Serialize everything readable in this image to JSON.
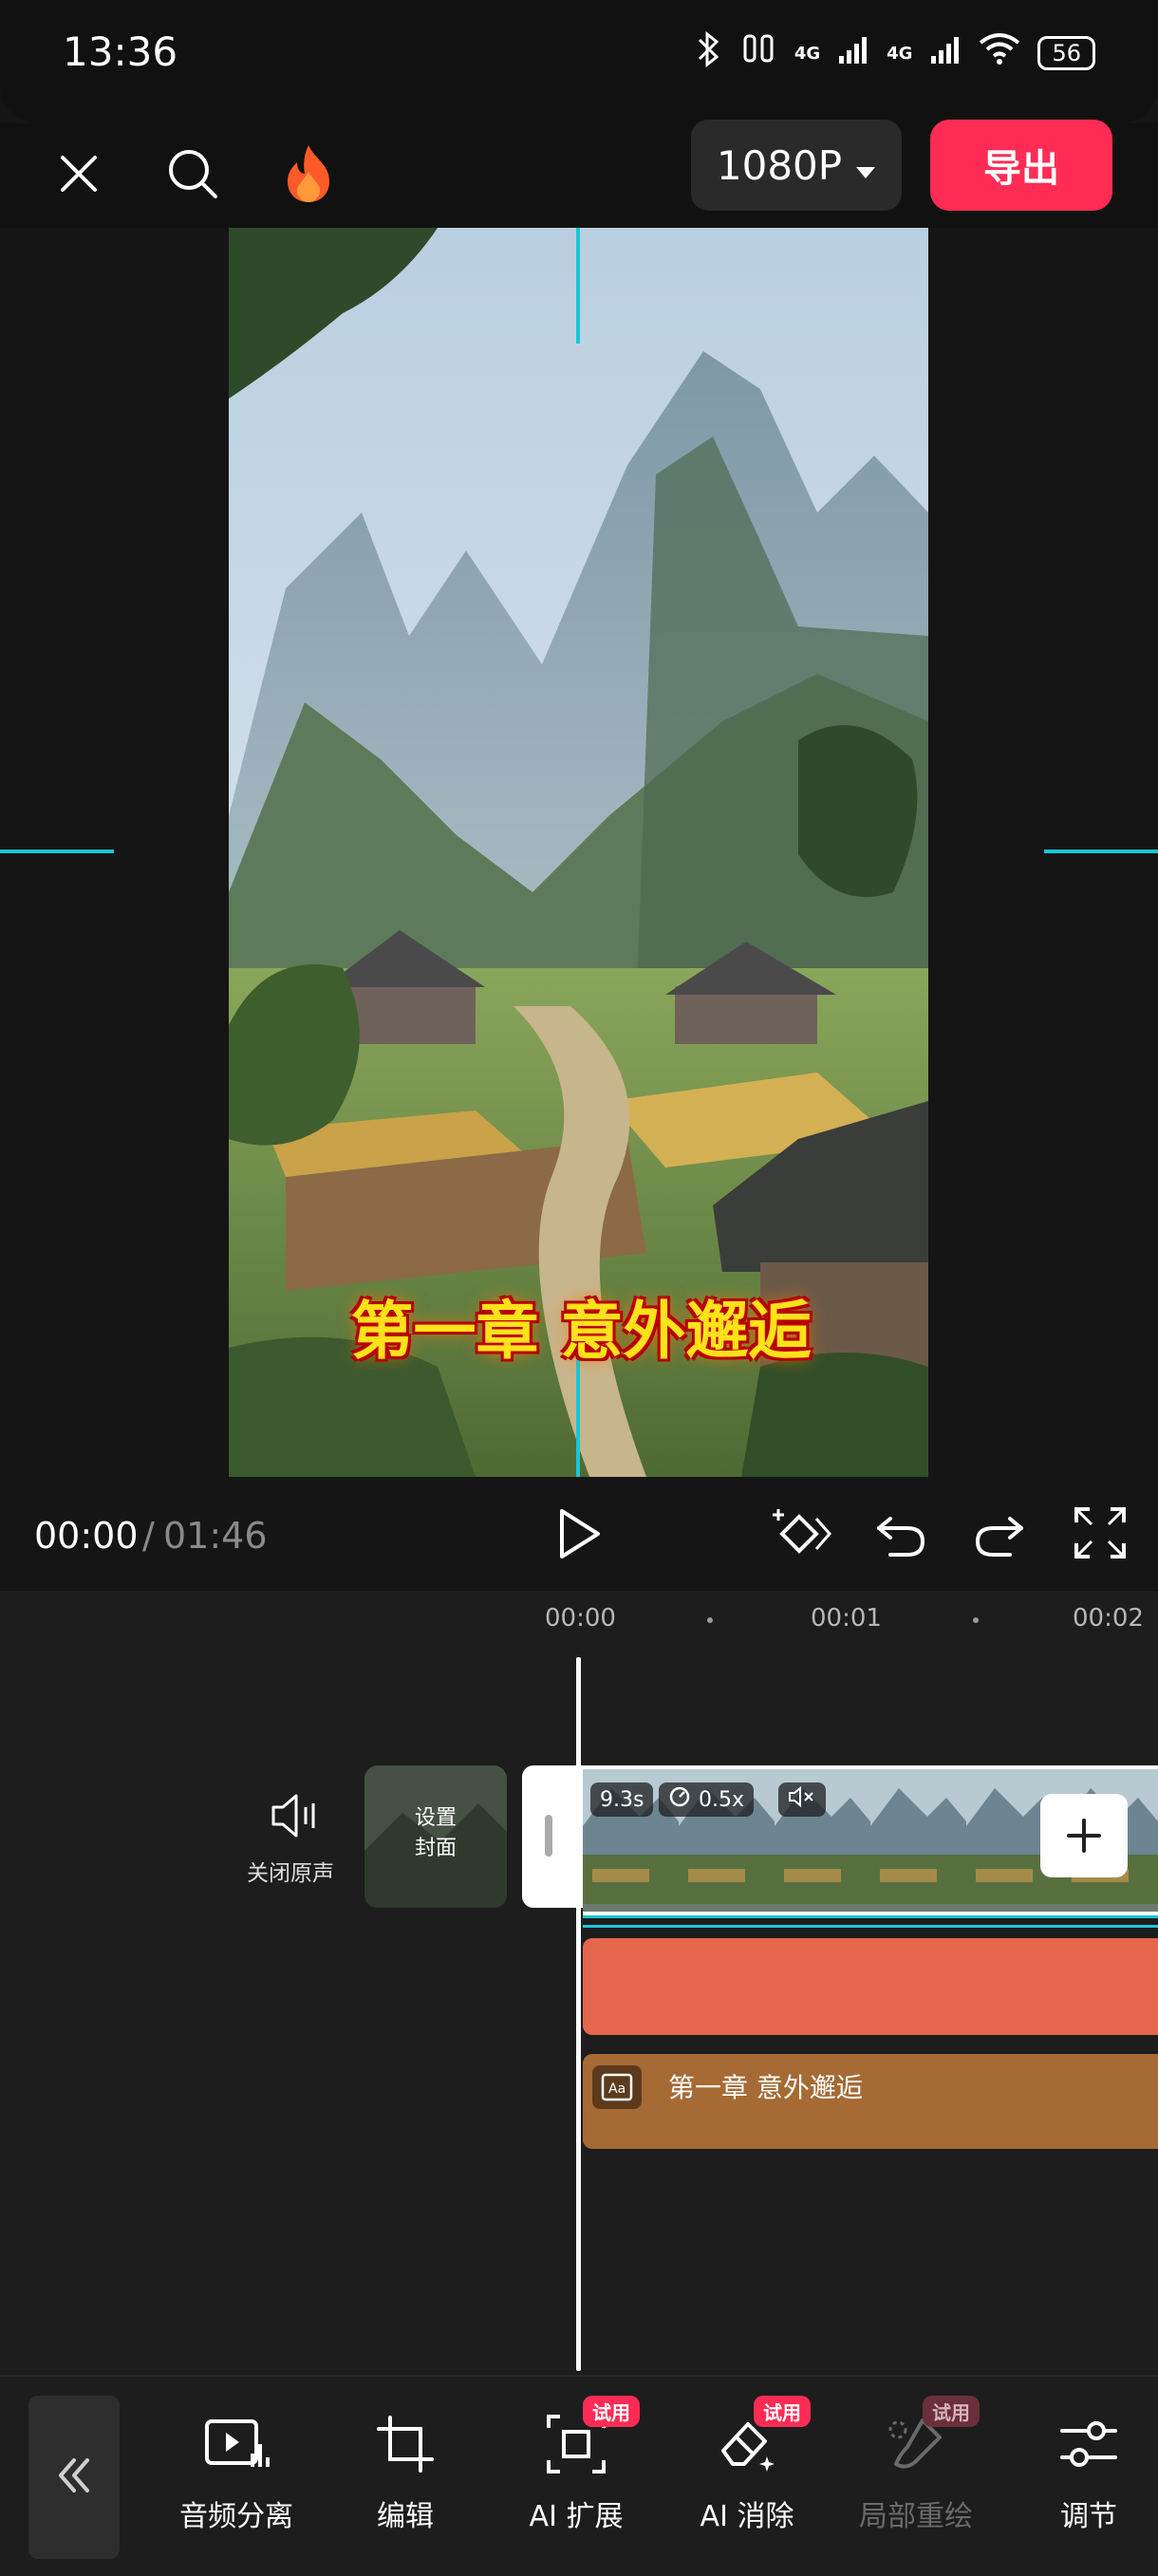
{
  "status_bar": {
    "time": "13:36",
    "battery": "56",
    "network_1": "4G",
    "network_2": "4G"
  },
  "top_bar": {
    "resolution": "1080P",
    "export_label": "导出"
  },
  "preview": {
    "caption": "第一章 意外邂逅"
  },
  "playback": {
    "current_time": "00:00",
    "separator": "/",
    "total_time": "01:46"
  },
  "timeline": {
    "ruler": [
      "00:00",
      "00:01",
      "00:02"
    ],
    "mute_label": "关闭原声",
    "cover_label_1": "设置",
    "cover_label_2": "封面",
    "clip_duration": "9.3s",
    "clip_speed": "0.5x",
    "text_track_label": "第一章 意外邂逅"
  },
  "toolbar": {
    "items": [
      {
        "label": "音频分离",
        "icon": "audio-split-icon"
      },
      {
        "label": "编辑",
        "icon": "crop-icon"
      },
      {
        "label": "AI 扩展",
        "icon": "ai-expand-icon",
        "badge": "试用"
      },
      {
        "label": "AI 消除",
        "icon": "ai-erase-icon",
        "badge": "试用"
      },
      {
        "label": "局部重绘",
        "icon": "repaint-icon",
        "badge": "试用",
        "disabled": true
      },
      {
        "label": "调节",
        "icon": "adjust-icon"
      }
    ]
  },
  "colors": {
    "accent": "#fe2c55",
    "guide": "#19c6d6",
    "audio_track": "#e5664c",
    "text_track": "#a66a34"
  }
}
